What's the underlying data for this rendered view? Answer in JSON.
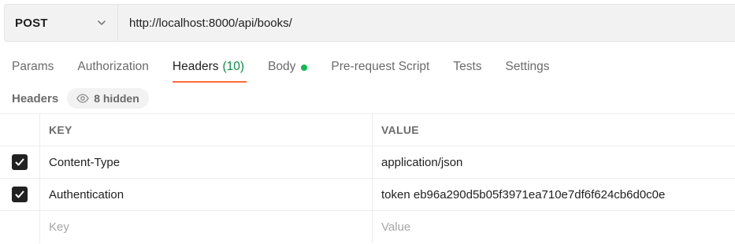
{
  "request": {
    "method": "POST",
    "url": "http://localhost:8000/api/books/"
  },
  "tabs": [
    {
      "label": "Params"
    },
    {
      "label": "Authorization"
    },
    {
      "label": "Headers",
      "count": "(10)",
      "active": true
    },
    {
      "label": "Body",
      "indicator": "green-dot"
    },
    {
      "label": "Pre-request Script"
    },
    {
      "label": "Tests"
    },
    {
      "label": "Settings"
    }
  ],
  "headers_section": {
    "title": "Headers",
    "hidden_label": "8 hidden",
    "hidden_icon": "eye-icon"
  },
  "table": {
    "columns": [
      "KEY",
      "VALUE"
    ],
    "rows": [
      {
        "checked": true,
        "key": "Content-Type",
        "value": "application/json"
      },
      {
        "checked": true,
        "key": "Authentication",
        "value": "token eb96a290d5b05f3971ea710e7df6f624cb6d0c0e"
      }
    ],
    "placeholder": {
      "key": "Key",
      "value": "Value"
    }
  },
  "colors": {
    "active_tab_underline": "#ff6c37",
    "count_green": "#0c8c42",
    "body_dot": "#0cbb52"
  }
}
